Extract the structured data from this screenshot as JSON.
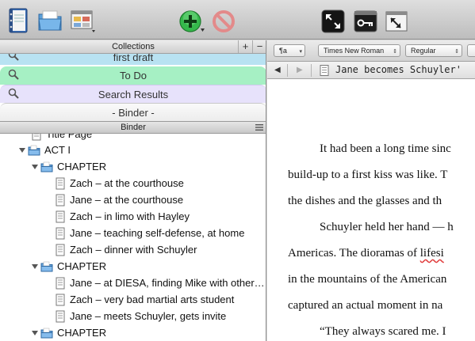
{
  "toolbar": {
    "buttons": [
      {
        "name": "binder-icon"
      },
      {
        "name": "folder-icon"
      },
      {
        "name": "corkboard-icon"
      },
      {
        "name": "add-icon"
      },
      {
        "name": "delete-icon"
      },
      {
        "name": "fullscreen-icon"
      },
      {
        "name": "keywords-icon"
      },
      {
        "name": "inspector-icon"
      }
    ]
  },
  "collections": {
    "header": "Collections",
    "add_label": "+",
    "remove_label": "−",
    "tabs": [
      {
        "label": "first draft",
        "color": "#b8e2f2"
      },
      {
        "label": "To Do",
        "color": "#a6f0c4"
      },
      {
        "label": "Search Results",
        "color": "#e7e2fb"
      },
      {
        "label": "- Binder -",
        "color": "#f2f2f2"
      }
    ]
  },
  "binder": {
    "header": "Binder",
    "items": [
      {
        "label": "Title Page",
        "type": "document"
      },
      {
        "label": "ACT I",
        "type": "folder"
      },
      {
        "label": "CHAPTER",
        "type": "folder"
      },
      {
        "label": "Zach – at the courthouse",
        "type": "document"
      },
      {
        "label": "Jane – at the courthouse",
        "type": "document"
      },
      {
        "label": "Zach – in limo with Hayley",
        "type": "document"
      },
      {
        "label": "Jane – teaching self-defense, at home",
        "type": "document"
      },
      {
        "label": "Zach – dinner with Schuyler",
        "type": "document"
      },
      {
        "label": "CHAPTER",
        "type": "folder"
      },
      {
        "label": "Jane – at DIESA, finding Mike with other…",
        "type": "document"
      },
      {
        "label": "Zach – very bad martial arts student",
        "type": "document"
      },
      {
        "label": "Jane – meets Schuyler, gets invite",
        "type": "document"
      },
      {
        "label": "CHAPTER",
        "type": "folder"
      }
    ]
  },
  "format_bar": {
    "paragraph": "¶a",
    "font": "Times New Roman",
    "style": "Regular",
    "size": ""
  },
  "editor": {
    "doc_title": "Jane becomes Schuyler'",
    "paragraphs": [
      {
        "text": "It had been a long time sinc"
      },
      {
        "text": "build-up to a first kiss was like. T"
      },
      {
        "text": "the dishes and the glasses and th"
      },
      {
        "text": "Schuyler held her hand — h"
      },
      {
        "text": "Americas. The dioramas of ",
        "spell": "lifesi"
      },
      {
        "text": "in the mountains of the American"
      },
      {
        "text": "captured an actual moment in na"
      },
      {
        "text": "“They always scared me. I"
      }
    ]
  }
}
